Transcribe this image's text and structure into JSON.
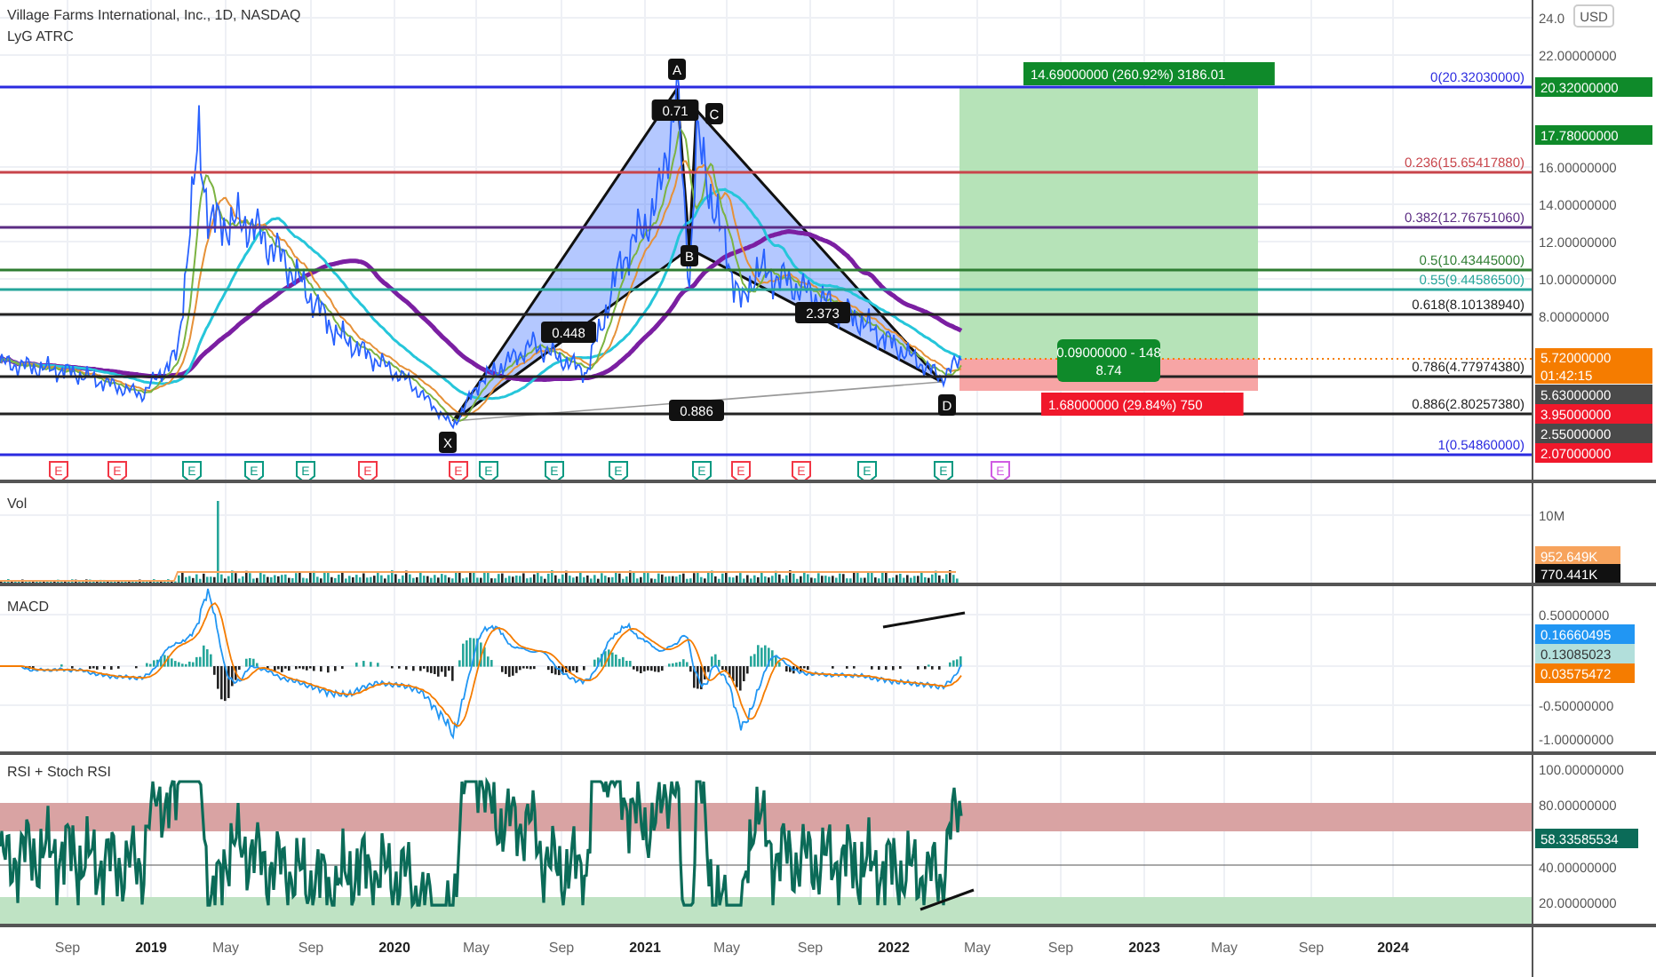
{
  "header": {
    "title": "Village Farms International, Inc., 1D, NASDAQ",
    "indicator": "LyG ATRC"
  },
  "main_pane": {
    "currency": "USD",
    "axis_labels": [
      "24.0",
      "22.00000000",
      "16.00000000",
      "14.00000000",
      "12.00000000",
      "10.00000000",
      "8.00000000"
    ],
    "price_tags": [
      {
        "text": "20.32000000",
        "color": "#0f8a2a"
      },
      {
        "text": "17.78000000",
        "color": "#0f8a2a"
      },
      {
        "text": "5.72000000",
        "sub": "01:42:15",
        "color": "#f57c00"
      },
      {
        "text": "5.63000000",
        "color": "#4a4a4a"
      },
      {
        "text": "3.95000000",
        "color": "#f0182b"
      },
      {
        "text": "2.55000000",
        "color": "#4a4a4a"
      },
      {
        "text": "2.07000000",
        "color": "#f0182b"
      }
    ],
    "fib_levels": [
      {
        "label": "0(20.32030000)",
        "color": "#2a2ae0"
      },
      {
        "label": "0.236(15.65417880)",
        "color": "#c8454b"
      },
      {
        "label": "0.382(12.76751060)",
        "color": "#5b2c83"
      },
      {
        "label": "0.5(10.43445000)",
        "color": "#2e7d32"
      },
      {
        "label": "0.55(9.44586500)",
        "color": "#26a69a"
      },
      {
        "label": "0.618(8.10138940)",
        "color": "#222222"
      },
      {
        "label": "0.786(4.77974380)",
        "color": "#222222"
      },
      {
        "label": "0.886(2.80257380)",
        "color": "#222222"
      },
      {
        "label": "1(0.54860000)",
        "color": "#2a2ae0"
      }
    ],
    "position": {
      "target": "14.69000000 (260.92%) 3186.01",
      "entry": [
        "0.09000000 - 148",
        "8.74"
      ],
      "stop": "1.68000000 (29.84%) 750"
    },
    "pattern": {
      "points": [
        "X",
        "A",
        "B",
        "C",
        "D"
      ],
      "ratios": [
        "0.448",
        "0.71",
        "2.373",
        "0.886"
      ]
    },
    "events": [
      {
        "text": "E",
        "color": "#f23645"
      },
      {
        "text": "E",
        "color": "#f23645"
      },
      {
        "text": "E",
        "color": "#089981"
      },
      {
        "text": "E",
        "color": "#089981"
      },
      {
        "text": "E",
        "color": "#089981"
      },
      {
        "text": "E",
        "color": "#f23645"
      },
      {
        "text": "E",
        "color": "#f23645"
      },
      {
        "text": "E",
        "color": "#089981"
      },
      {
        "text": "E",
        "color": "#089981"
      },
      {
        "text": "E",
        "color": "#089981"
      },
      {
        "text": "E",
        "color": "#089981"
      },
      {
        "text": "E",
        "color": "#f23645"
      },
      {
        "text": "E",
        "color": "#f23645"
      },
      {
        "text": "E",
        "color": "#089981"
      },
      {
        "text": "E",
        "color": "#089981"
      },
      {
        "text": "E",
        "color": "#d05ce3"
      }
    ]
  },
  "volume_pane": {
    "title": "Vol",
    "axis_labels": [
      "10M"
    ],
    "tags": [
      {
        "text": "952.649K",
        "color": "#f7a35c"
      },
      {
        "text": "770.441K",
        "color": "#111111"
      }
    ]
  },
  "macd_pane": {
    "title": "MACD",
    "axis_labels": [
      "0.50000000",
      "-0.50000000",
      "-1.00000000"
    ],
    "tags": [
      {
        "text": "0.16660495",
        "color": "#2196f3"
      },
      {
        "text": "0.13085023",
        "color": "#b2dfdb"
      },
      {
        "text": "0.03575472",
        "color": "#f57c00"
      }
    ]
  },
  "rsi_pane": {
    "title": "RSI + Stoch RSI",
    "axis_labels": [
      "100.00000000",
      "80.00000000",
      "40.00000000",
      "20.00000000"
    ],
    "tags": [
      {
        "text": "58.33585534",
        "color": "#0b6b58"
      }
    ]
  },
  "time_axis": [
    {
      "label": "Sep",
      "kind": "month"
    },
    {
      "label": "2019",
      "kind": "year"
    },
    {
      "label": "May",
      "kind": "month"
    },
    {
      "label": "Sep",
      "kind": "month"
    },
    {
      "label": "2020",
      "kind": "year"
    },
    {
      "label": "May",
      "kind": "month"
    },
    {
      "label": "Sep",
      "kind": "month"
    },
    {
      "label": "2021",
      "kind": "year"
    },
    {
      "label": "May",
      "kind": "month"
    },
    {
      "label": "Sep",
      "kind": "month"
    },
    {
      "label": "2022",
      "kind": "year"
    },
    {
      "label": "May",
      "kind": "month"
    },
    {
      "label": "Sep",
      "kind": "month"
    },
    {
      "label": "2023",
      "kind": "year"
    },
    {
      "label": "May",
      "kind": "month"
    },
    {
      "label": "Sep",
      "kind": "month"
    },
    {
      "label": "2024",
      "kind": "year"
    }
  ]
}
